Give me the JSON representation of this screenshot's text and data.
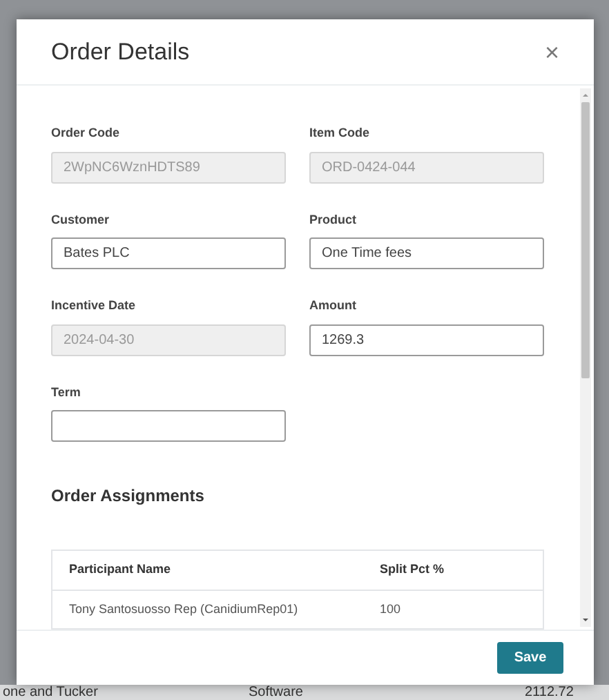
{
  "background_row": [
    "one and Tucker",
    "Software",
    "2112.72"
  ],
  "dialog": {
    "title": "Order Details",
    "close": "×"
  },
  "fields": [
    {
      "label": "Order Code",
      "value": "2WpNC6WznHDTS89",
      "disabled": true
    },
    {
      "label": "Item Code",
      "value": "ORD-0424-044",
      "disabled": true
    },
    {
      "label": "Customer",
      "value": "Bates PLC",
      "disabled": false
    },
    {
      "label": "Product",
      "value": "One Time fees",
      "disabled": false
    },
    {
      "label": "Incentive Date",
      "value": "2024-04-30",
      "disabled": true
    },
    {
      "label": "Amount",
      "value": "1269.3",
      "disabled": false
    },
    {
      "label": "Term",
      "disabled": false
    }
  ],
  "assignments": {
    "heading": "Order Assignments",
    "columns": [
      "Participant Name",
      "Split Pct %"
    ],
    "rows": [
      [
        "Tony Santosuosso Rep (CanidiumRep01)",
        "100"
      ]
    ]
  },
  "footer": {
    "save": "Save"
  }
}
